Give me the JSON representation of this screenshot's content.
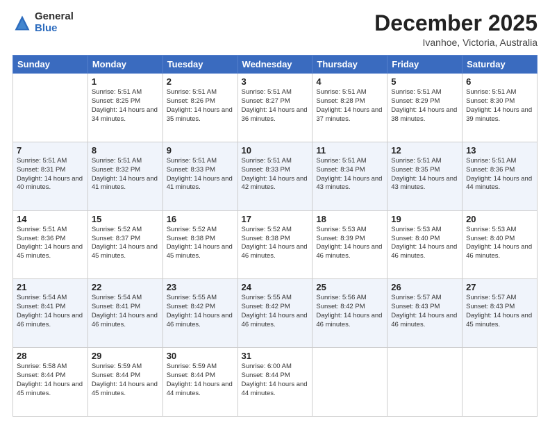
{
  "header": {
    "logo_general": "General",
    "logo_blue": "Blue",
    "month_title": "December 2025",
    "subtitle": "Ivanhoe, Victoria, Australia"
  },
  "days_of_week": [
    "Sunday",
    "Monday",
    "Tuesday",
    "Wednesday",
    "Thursday",
    "Friday",
    "Saturday"
  ],
  "weeks": [
    [
      {
        "day": "",
        "info": ""
      },
      {
        "day": "1",
        "info": "Sunrise: 5:51 AM\nSunset: 8:25 PM\nDaylight: 14 hours\nand 34 minutes."
      },
      {
        "day": "2",
        "info": "Sunrise: 5:51 AM\nSunset: 8:26 PM\nDaylight: 14 hours\nand 35 minutes."
      },
      {
        "day": "3",
        "info": "Sunrise: 5:51 AM\nSunset: 8:27 PM\nDaylight: 14 hours\nand 36 minutes."
      },
      {
        "day": "4",
        "info": "Sunrise: 5:51 AM\nSunset: 8:28 PM\nDaylight: 14 hours\nand 37 minutes."
      },
      {
        "day": "5",
        "info": "Sunrise: 5:51 AM\nSunset: 8:29 PM\nDaylight: 14 hours\nand 38 minutes."
      },
      {
        "day": "6",
        "info": "Sunrise: 5:51 AM\nSunset: 8:30 PM\nDaylight: 14 hours\nand 39 minutes."
      }
    ],
    [
      {
        "day": "7",
        "info": "Sunrise: 5:51 AM\nSunset: 8:31 PM\nDaylight: 14 hours\nand 40 minutes."
      },
      {
        "day": "8",
        "info": "Sunrise: 5:51 AM\nSunset: 8:32 PM\nDaylight: 14 hours\nand 41 minutes."
      },
      {
        "day": "9",
        "info": "Sunrise: 5:51 AM\nSunset: 8:33 PM\nDaylight: 14 hours\nand 41 minutes."
      },
      {
        "day": "10",
        "info": "Sunrise: 5:51 AM\nSunset: 8:33 PM\nDaylight: 14 hours\nand 42 minutes."
      },
      {
        "day": "11",
        "info": "Sunrise: 5:51 AM\nSunset: 8:34 PM\nDaylight: 14 hours\nand 43 minutes."
      },
      {
        "day": "12",
        "info": "Sunrise: 5:51 AM\nSunset: 8:35 PM\nDaylight: 14 hours\nand 43 minutes."
      },
      {
        "day": "13",
        "info": "Sunrise: 5:51 AM\nSunset: 8:36 PM\nDaylight: 14 hours\nand 44 minutes."
      }
    ],
    [
      {
        "day": "14",
        "info": "Sunrise: 5:51 AM\nSunset: 8:36 PM\nDaylight: 14 hours\nand 45 minutes."
      },
      {
        "day": "15",
        "info": "Sunrise: 5:52 AM\nSunset: 8:37 PM\nDaylight: 14 hours\nand 45 minutes."
      },
      {
        "day": "16",
        "info": "Sunrise: 5:52 AM\nSunset: 8:38 PM\nDaylight: 14 hours\nand 45 minutes."
      },
      {
        "day": "17",
        "info": "Sunrise: 5:52 AM\nSunset: 8:38 PM\nDaylight: 14 hours\nand 46 minutes."
      },
      {
        "day": "18",
        "info": "Sunrise: 5:53 AM\nSunset: 8:39 PM\nDaylight: 14 hours\nand 46 minutes."
      },
      {
        "day": "19",
        "info": "Sunrise: 5:53 AM\nSunset: 8:40 PM\nDaylight: 14 hours\nand 46 minutes."
      },
      {
        "day": "20",
        "info": "Sunrise: 5:53 AM\nSunset: 8:40 PM\nDaylight: 14 hours\nand 46 minutes."
      }
    ],
    [
      {
        "day": "21",
        "info": "Sunrise: 5:54 AM\nSunset: 8:41 PM\nDaylight: 14 hours\nand 46 minutes."
      },
      {
        "day": "22",
        "info": "Sunrise: 5:54 AM\nSunset: 8:41 PM\nDaylight: 14 hours\nand 46 minutes."
      },
      {
        "day": "23",
        "info": "Sunrise: 5:55 AM\nSunset: 8:42 PM\nDaylight: 14 hours\nand 46 minutes."
      },
      {
        "day": "24",
        "info": "Sunrise: 5:55 AM\nSunset: 8:42 PM\nDaylight: 14 hours\nand 46 minutes."
      },
      {
        "day": "25",
        "info": "Sunrise: 5:56 AM\nSunset: 8:42 PM\nDaylight: 14 hours\nand 46 minutes."
      },
      {
        "day": "26",
        "info": "Sunrise: 5:57 AM\nSunset: 8:43 PM\nDaylight: 14 hours\nand 46 minutes."
      },
      {
        "day": "27",
        "info": "Sunrise: 5:57 AM\nSunset: 8:43 PM\nDaylight: 14 hours\nand 45 minutes."
      }
    ],
    [
      {
        "day": "28",
        "info": "Sunrise: 5:58 AM\nSunset: 8:44 PM\nDaylight: 14 hours\nand 45 minutes."
      },
      {
        "day": "29",
        "info": "Sunrise: 5:59 AM\nSunset: 8:44 PM\nDaylight: 14 hours\nand 45 minutes."
      },
      {
        "day": "30",
        "info": "Sunrise: 5:59 AM\nSunset: 8:44 PM\nDaylight: 14 hours\nand 44 minutes."
      },
      {
        "day": "31",
        "info": "Sunrise: 6:00 AM\nSunset: 8:44 PM\nDaylight: 14 hours\nand 44 minutes."
      },
      {
        "day": "",
        "info": ""
      },
      {
        "day": "",
        "info": ""
      },
      {
        "day": "",
        "info": ""
      }
    ]
  ]
}
